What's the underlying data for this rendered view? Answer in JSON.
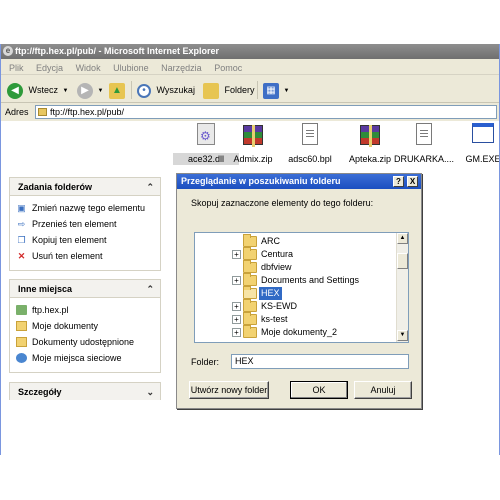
{
  "window": {
    "title": "ftp://ftp.hex.pl/pub/ - Microsoft Internet Explorer"
  },
  "menu": [
    "Plik",
    "Edycja",
    "Widok",
    "Ulubione",
    "Narzędzia",
    "Pomoc"
  ],
  "toolbar": {
    "back_label": "Wstecz",
    "search_label": "Wyszukaj",
    "folders_label": "Foldery"
  },
  "address": {
    "label": "Adres",
    "value": "ftp://ftp.hex.pl/pub/"
  },
  "left_pane": {
    "tasks": {
      "title": "Zadania folderów",
      "items": [
        {
          "label": "Zmień nazwę tego elementu",
          "icon": "rename-icon"
        },
        {
          "label": "Przenieś ten element",
          "icon": "move-icon"
        },
        {
          "label": "Kopiuj ten element",
          "icon": "copy-icon"
        },
        {
          "label": "Usuń ten element",
          "icon": "delete-icon"
        }
      ]
    },
    "places": {
      "title": "Inne miejsca",
      "items": [
        {
          "label": "ftp.hex.pl",
          "icon": "ftp-icon"
        },
        {
          "label": "Moje dokumenty",
          "icon": "folder-icon"
        },
        {
          "label": "Dokumenty udostępnione",
          "icon": "folder-icon"
        },
        {
          "label": "Moje miejsca sieciowe",
          "icon": "network-icon"
        }
      ]
    },
    "details": {
      "title": "Szczegóły"
    }
  },
  "files": [
    {
      "name": "ace32.dll",
      "type": "dll",
      "selected": true
    },
    {
      "name": "Admix.zip",
      "type": "rar"
    },
    {
      "name": "adsc60.bpl",
      "type": "doc"
    },
    {
      "name": "Apteka.zip",
      "type": "rar"
    },
    {
      "name": "DRUKARKA....",
      "type": "doc"
    },
    {
      "name": "GM.EXE",
      "type": "exe"
    }
  ],
  "dialog": {
    "title": "Przeglądanie w poszukiwaniu folderu",
    "help_btn": "?",
    "close_btn": "X",
    "message": "Skopuj zaznaczone elementy do tego folderu:",
    "tree": [
      {
        "label": "ARC",
        "expander": false,
        "selected": false
      },
      {
        "label": "Centura",
        "expander": true,
        "selected": false
      },
      {
        "label": "dbfview",
        "expander": false,
        "selected": false
      },
      {
        "label": "Documents and Settings",
        "expander": true,
        "selected": false
      },
      {
        "label": "HEX",
        "expander": false,
        "selected": true
      },
      {
        "label": "KS-EWD",
        "expander": true,
        "selected": false
      },
      {
        "label": "ks-test",
        "expander": true,
        "selected": false
      },
      {
        "label": "Moje dokumenty_2",
        "expander": true,
        "selected": false
      }
    ],
    "folder_label": "Folder:",
    "folder_value": "HEX",
    "new_folder_btn": "Utwórz nowy folder",
    "ok_btn": "OK",
    "cancel_btn": "Anuluj"
  }
}
